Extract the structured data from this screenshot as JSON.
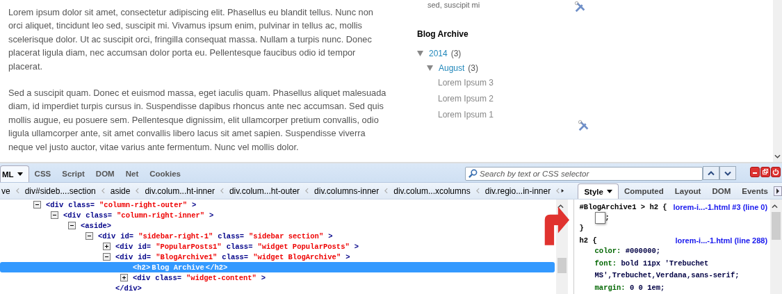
{
  "page": {
    "paragraphs": [
      "Lorem ipsum dolor sit amet, consectetur adipiscing elit. Phasellus eu blandit tellus. Nunc non orci aliquet, tincidunt leo sed, suscipit mi. Vivamus ipsum enim, pulvinar in tellus ac, mollis scelerisque dolor. Ut ac suscipit orci, fringilla consequat massa. Nullam a turpis nunc. Donec placerat ligula diam, nec accumsan dolor porta eu. Pellentesque faucibus odio id tempor placerat.",
      "Sed a suscipit quam. Donec et euismod massa, eget iaculis quam. Phasellus aliquet malesuada diam, id imperdiet turpis cursus in. Suspendisse dapibus rhoncus ante nec accumsan. Sed quis mollis augue, eu posuere sem. Pellentesque dignissim, elit ullamcorper pretium convallis, odio ligula ullamcorper ante, sit amet convallis libero lacus sit amet sapien. Suspendisse viverra neque vel justo auctor, vitae varius ante fermentum. Nunc vel mollis dolor."
    ]
  },
  "sidebar": {
    "cut_text": "sed, suscipit mi",
    "archive": {
      "title": "Blog Archive",
      "years": [
        {
          "label": "2014",
          "count": "(3)",
          "expanded": true,
          "months": [
            {
              "label": "August",
              "count": "(3)",
              "expanded": true,
              "posts": [
                "Lorem Ipsum 3",
                "Lorem Ipsum 2",
                "Lorem Ipsum 1"
              ]
            }
          ]
        }
      ]
    }
  },
  "firebug": {
    "tabs": [
      {
        "label": "ML",
        "selected": true
      },
      {
        "label": "CSS",
        "selected": false
      },
      {
        "label": "Script",
        "selected": false
      },
      {
        "label": "DOM",
        "selected": false
      },
      {
        "label": "Net",
        "selected": false
      },
      {
        "label": "Cookies",
        "selected": false
      }
    ],
    "search": {
      "placeholder": "Search by text or CSS selector"
    },
    "breadcrumbs": [
      "ve",
      "div#sideb....section",
      "aside",
      "div.colum...ht-inner",
      "div.colum...ht-outer",
      "div.columns-inner",
      "div.colum...xcolumns",
      "div.regio...in-inner"
    ],
    "side_tabs": [
      {
        "label": "Style",
        "selected": true
      },
      {
        "label": "Computed",
        "selected": false
      },
      {
        "label": "Layout",
        "selected": false
      },
      {
        "label": "DOM",
        "selected": false
      },
      {
        "label": "Events",
        "selected": false
      }
    ],
    "tree": [
      {
        "expanded": true,
        "selected": false,
        "tokens": [
          {
            "kind": "tag",
            "text": "<div"
          },
          {
            "kind": "attr",
            "text": "class="
          },
          {
            "kind": "value",
            "text": "\"column-right-outer\""
          },
          {
            "kind": "tag",
            "text": ">"
          }
        ],
        "children": [
          {
            "expanded": true,
            "selected": false,
            "tokens": [
              {
                "kind": "tag",
                "text": "<div"
              },
              {
                "kind": "attr",
                "text": "class="
              },
              {
                "kind": "value",
                "text": "\"column-right-inner\""
              },
              {
                "kind": "tag",
                "text": ">"
              }
            ],
            "children": [
              {
                "expanded": true,
                "selected": false,
                "tokens": [
                  {
                    "kind": "tag",
                    "text": "<aside>"
                  }
                ],
                "children": [
                  {
                    "expanded": true,
                    "selected": false,
                    "tokens": [
                      {
                        "kind": "tag",
                        "text": "<div"
                      },
                      {
                        "kind": "attr",
                        "text": "id="
                      },
                      {
                        "kind": "value",
                        "text": "\"sidebar-right-1\""
                      },
                      {
                        "kind": "attr",
                        "text": "class="
                      },
                      {
                        "kind": "value",
                        "text": "\"sidebar section\""
                      },
                      {
                        "kind": "tag",
                        "text": ">"
                      }
                    ],
                    "children": [
                      {
                        "expanded": false,
                        "selected": false,
                        "tokens": [
                          {
                            "kind": "tag",
                            "text": "<div"
                          },
                          {
                            "kind": "attr",
                            "text": "id="
                          },
                          {
                            "kind": "value",
                            "text": "\"PopularPosts1\""
                          },
                          {
                            "kind": "attr",
                            "text": "class="
                          },
                          {
                            "kind": "value",
                            "text": "\"widget PopularPosts\""
                          },
                          {
                            "kind": "tag",
                            "text": ">"
                          }
                        ]
                      },
                      {
                        "expanded": true,
                        "selected": false,
                        "tokens": [
                          {
                            "kind": "tag",
                            "text": "<div"
                          },
                          {
                            "kind": "attr",
                            "text": "id="
                          },
                          {
                            "kind": "value",
                            "text": "\"BlogArchive1\""
                          },
                          {
                            "kind": "attr",
                            "text": "class="
                          },
                          {
                            "kind": "value",
                            "text": "\"widget BlogArchive\""
                          },
                          {
                            "kind": "tag",
                            "text": ">"
                          }
                        ],
                        "children": [
                          {
                            "selected": true,
                            "tokens": [
                              {
                                "kind": "tag",
                                "text": "<h2>"
                              },
                              {
                                "kind": "text",
                                "text": "Blog Archive"
                              },
                              {
                                "kind": "tag",
                                "text": "</h2>"
                              }
                            ]
                          },
                          {
                            "expanded": false,
                            "selected": false,
                            "tokens": [
                              {
                                "kind": "tag",
                                "text": "<div"
                              },
                              {
                                "kind": "attr",
                                "text": "class="
                              },
                              {
                                "kind": "value",
                                "text": "\"widget-content\""
                              },
                              {
                                "kind": "tag",
                                "text": ">"
                              }
                            ]
                          }
                        ]
                      },
                      {
                        "selected": false,
                        "tokens": [
                          {
                            "kind": "tag",
                            "text": "</div>"
                          }
                        ]
                      }
                    ]
                  }
                ]
              }
            ]
          }
        ]
      }
    ],
    "rules": [
      {
        "selector": "#BlogArchive1 > h2 {",
        "source": "lorem-i...-1.html #3 (line 0)",
        "declarations": [
          {
            "kind": "editor",
            "text": ";"
          }
        ],
        "close": "}"
      },
      {
        "selector": "h2 {",
        "source": "lorem-i...-1.html (line 288)",
        "declarations": [
          {
            "kind": "prop",
            "name": "color:",
            "value": "#000000;"
          },
          {
            "kind": "prop",
            "name": "font:",
            "value": "bold 11px 'Trebuchet MS',Trebuchet,Verdana,sans-serif;"
          },
          {
            "kind": "prop",
            "name": "margin:",
            "value": "0 0 1em;"
          }
        ]
      }
    ]
  }
}
